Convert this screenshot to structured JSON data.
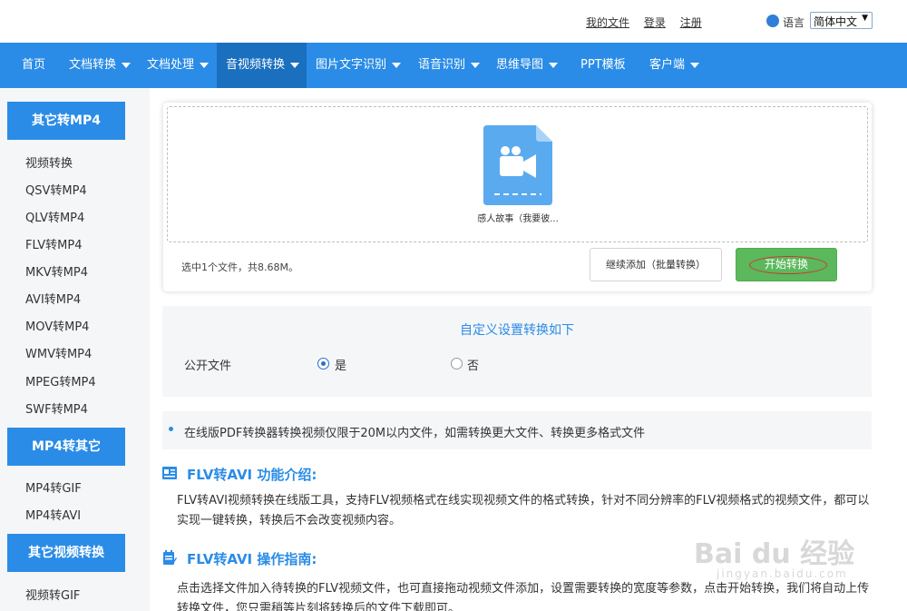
{
  "top_links": {
    "my_files": "我的文件",
    "login": "登录",
    "register": "注册",
    "language_label": "语言",
    "language_value": "简体中文"
  },
  "nav": {
    "items": [
      {
        "label": "首页",
        "has_caret": false
      },
      {
        "label": "文档转换",
        "has_caret": true
      },
      {
        "label": "文档处理",
        "has_caret": true
      },
      {
        "label": "音视频转换",
        "has_caret": true,
        "active": true
      },
      {
        "label": "图片文字识别",
        "has_caret": true
      },
      {
        "label": "语音识别",
        "has_caret": true
      },
      {
        "label": "思维导图",
        "has_caret": true
      },
      {
        "label": "PPT模板",
        "has_caret": false
      },
      {
        "label": "客户端",
        "has_caret": true
      }
    ]
  },
  "sidebar": {
    "group1_title": "其它转MP4",
    "group1_items": [
      "视频转换",
      "QSV转MP4",
      "QLV转MP4",
      "FLV转MP4",
      "MKV转MP4",
      "AVI转MP4",
      "MOV转MP4",
      "WMV转MP4",
      "MPEG转MP4",
      "SWF转MP4"
    ],
    "group2_title": "MP4转其它",
    "group2_items": [
      "MP4转GIF",
      "MP4转AVI"
    ],
    "group3_title": "其它视频转换",
    "group3_items": [
      "视频转GIF"
    ]
  },
  "upload": {
    "file_name": "感人故事（我要彼...",
    "selection_info": "选中1个文件，共8.68M。",
    "add_more_label": "继续添加（批量转换）",
    "start_label": "开始转换"
  },
  "settings": {
    "title": "自定义设置转换如下",
    "public_label": "公开文件",
    "option_yes": "是",
    "option_no": "否",
    "selected": "是"
  },
  "notice": {
    "text": "在线版PDF转换器转换视频仅限于20M以内文件，如需转换更大文件、转换更多格式文件"
  },
  "intro": {
    "title": "FLV转AVI 功能介绍:",
    "body": "FLV转AVI视频转换在线版工具，支持FLV视频格式在线实现视频文件的格式转换，针对不同分辨率的FLV视频格式的视频文件，都可以实现一键转换，转换后不会改变视频内容。"
  },
  "guide": {
    "title": "FLV转AVI 操作指南:",
    "body": "点击选择文件加入待转换的FLV视频文件，也可直接拖动视频文件添加，设置需要转换的宽度等参数，点击开始转换，我们将自动上传转换文件，您只需稍等片刻将转换后的文件下载即可。"
  },
  "watermark": {
    "main": "Bai du 经验",
    "sub": "jingyan.baidu.com"
  },
  "colors": {
    "brand_blue": "#2a8ce6",
    "active_nav": "#1b6fbf",
    "start_green": "#5cb85c",
    "highlight_red": "#d0342c"
  }
}
